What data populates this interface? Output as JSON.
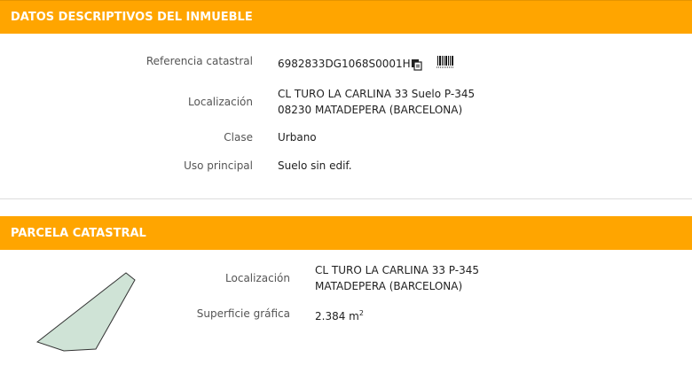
{
  "inmueble": {
    "title": "DATOS DESCRIPTIVOS DEL INMUEBLE",
    "referencia_label": "Referencia catastral",
    "referencia_value": "6982833DG1068S0001HR",
    "localizacion_label": "Localización",
    "localizacion_line1": "CL TURO LA CARLINA 33 Suelo P-345",
    "localizacion_line2": "08230 MATADEPERA (BARCELONA)",
    "clase_label": "Clase",
    "clase_value": "Urbano",
    "uso_label": "Uso principal",
    "uso_value": "Suelo sin edif."
  },
  "parcela": {
    "title": "PARCELA CATASTRAL",
    "localizacion_label": "Localización",
    "localizacion_line1": "CL TURO LA CARLINA 33 P-345",
    "localizacion_line2": "MATADEPERA (BARCELONA)",
    "superficie_label": "Superficie gráfica",
    "superficie_value": "2.384 m",
    "superficie_unit_exp": "2"
  },
  "icons": {
    "copy": "copy-icon",
    "barcode": "barcode-icon",
    "parcel_shape": "parcel-shape"
  },
  "colors": {
    "header_bg": "#ffa500",
    "header_text": "#ffffff",
    "parcel_fill": "#cfe3d6",
    "parcel_stroke": "#333333"
  }
}
